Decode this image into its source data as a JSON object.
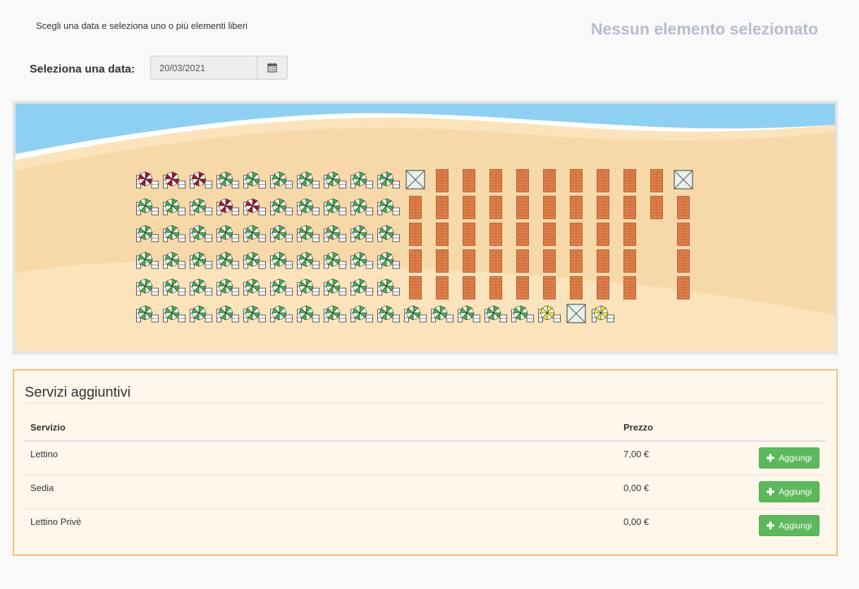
{
  "header": {
    "instructions": "Scegli una data e seleziona uno o più elementi liberi",
    "selection_status": "Nessun elemento selezionato"
  },
  "date": {
    "label": "Seleziona una data:",
    "value": "20/03/2021",
    "button_icon": "calendar-icon"
  },
  "beach_map": {
    "colors": {
      "sea": "#8ed0f2",
      "sea_light": "#a8dcf5",
      "sand": "#f7d9a9",
      "sand_light": "#fbe3bb",
      "umbrella_free": "#3fb541",
      "umbrella_busy": "#a8152d",
      "umbrella_special": "#f3ed28",
      "cabin": "#e0804c",
      "tent": "#e8f1ec"
    },
    "rows": [
      [
        "busy",
        "busy",
        "busy",
        "free",
        "free",
        "free",
        "free",
        "free",
        "free",
        "free",
        "tent",
        "cabin",
        "cabin",
        "cabin",
        "cabin",
        "cabin",
        "cabin",
        "cabin",
        "cabin",
        "cabin",
        "tent"
      ],
      [
        "free",
        "free",
        "free",
        "busy",
        "busy",
        "free",
        "free",
        "free",
        "free",
        "free",
        "cabin",
        "cabin",
        "cabin",
        "cabin",
        "cabin",
        "cabin",
        "cabin",
        "cabin",
        "cabin",
        "cabin",
        "cabin"
      ],
      [
        "free",
        "free",
        "free",
        "free",
        "free",
        "free",
        "free",
        "free",
        "free",
        "free",
        "cabin",
        "cabin",
        "cabin",
        "cabin",
        "cabin",
        "cabin",
        "cabin",
        "cabin",
        "cabin",
        "",
        "cabin"
      ],
      [
        "free",
        "free",
        "free",
        "free",
        "free",
        "free",
        "free",
        "free",
        "free",
        "free",
        "cabin",
        "cabin",
        "cabin",
        "cabin",
        "cabin",
        "cabin",
        "cabin",
        "cabin",
        "cabin",
        "",
        "cabin"
      ],
      [
        "free",
        "free",
        "free",
        "free",
        "free",
        "free",
        "free",
        "free",
        "free",
        "free",
        "cabin",
        "cabin",
        "cabin",
        "cabin",
        "cabin",
        "cabin",
        "cabin",
        "cabin",
        "cabin",
        "",
        "cabin"
      ],
      [
        "free",
        "free",
        "free",
        "free",
        "free",
        "free",
        "free",
        "free",
        "free",
        "free",
        "free",
        "free",
        "free",
        "free",
        "free",
        "special",
        "tent",
        "special"
      ]
    ]
  },
  "services": {
    "title": "Servizi aggiuntivi",
    "columns": {
      "service": "Servizio",
      "price": "Prezzo"
    },
    "items": [
      {
        "name": "Lettino",
        "price": "7,00 €",
        "button": "Aggiungi"
      },
      {
        "name": "Sedia",
        "price": "0,00 €",
        "button": "Aggiungi"
      },
      {
        "name": "Lettino Privè",
        "price": "0,00 €",
        "button": "Aggiungi"
      }
    ]
  }
}
